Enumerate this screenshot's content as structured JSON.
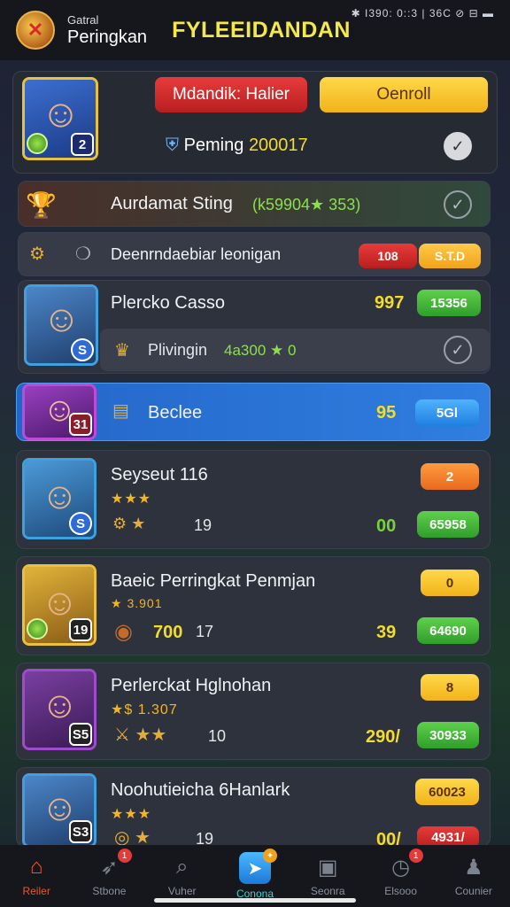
{
  "header": {
    "small_title": "Gatral",
    "title": "Peringkan",
    "brand": "FYLEEIDANDAN",
    "status": "✱ I390: 0::3 | 36C ⊘ ⊟ ▬"
  },
  "top_card": {
    "player_level": "2",
    "button_left": "Mdandik: Halier",
    "button_right": "Oenroll",
    "ranking_label": "Peming",
    "ranking_value": "200017"
  },
  "achievement": {
    "title": "Aurdamat Sting",
    "detail": "(k59904★ 353)"
  },
  "section": {
    "title": "Deenrndaebiar leonigan",
    "badge_red": "108",
    "badge_yellow": "S.T.D"
  },
  "players": [
    {
      "name": "Plercko Casso",
      "score": "997",
      "points": "15356",
      "level": "S",
      "sub_label": "Plivingin",
      "sub_value": "4a300 ★ 0"
    },
    {
      "name": "Beclee",
      "score": "95",
      "points": "5Gl",
      "level": "31"
    },
    {
      "name": "Seyseut 116",
      "stars": "★★★",
      "extra": "19",
      "score": "00",
      "points": "65958",
      "level": "S",
      "badge": "2"
    },
    {
      "name": "Baeic Perringkat Penmjan",
      "stars": "★ 3.901",
      "extra_a": "700",
      "extra": "17",
      "score": "39",
      "points": "64690",
      "level": "19",
      "badge": "0"
    },
    {
      "name": "Perlerckat Hglnohan",
      "stars": "★$ 1.307",
      "extra": "10",
      "score": "290/",
      "points": "30933",
      "level": "S5",
      "badge": "8"
    },
    {
      "name": "Noohutieicha 6Hanlark",
      "stars": "★★★",
      "extra": "19",
      "score": "00/",
      "points": "4931/",
      "level": "S3",
      "badge": "60023"
    }
  ],
  "nav": [
    {
      "label": "Reiler",
      "icon": "home-icon"
    },
    {
      "label": "Stbone",
      "icon": "rocket-icon",
      "badge": "1"
    },
    {
      "label": "Vuher",
      "icon": "search-icon"
    },
    {
      "label": "Conona",
      "icon": "send-icon",
      "badge": "✦"
    },
    {
      "label": "Seonra",
      "icon": "chest-icon"
    },
    {
      "label": "Elsooo",
      "icon": "clock-icon",
      "badge": "1"
    },
    {
      "label": "Counier",
      "icon": "user-icon"
    }
  ]
}
